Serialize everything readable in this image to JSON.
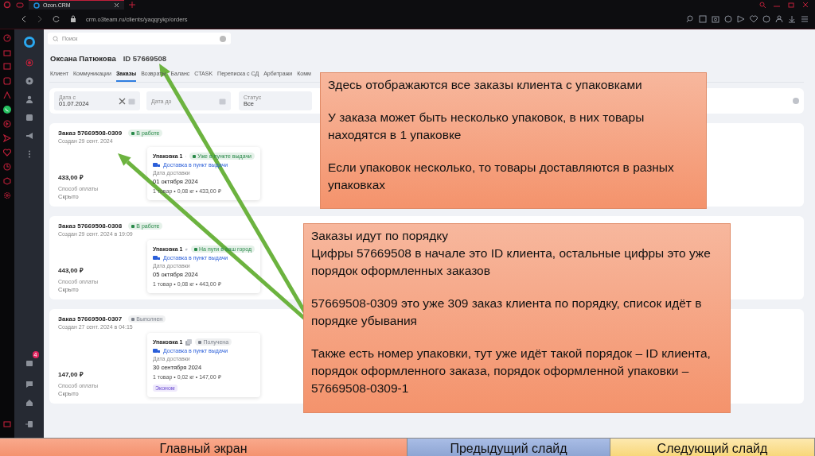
{
  "browser": {
    "tab_title": "Ozon.CRM",
    "url": "crm.o3team.ru/clients/yaqqrykp/orders"
  },
  "app_sidebar": {
    "notification_count": "4"
  },
  "search": {
    "placeholder": "Поиск"
  },
  "client": {
    "name": "Оксана Патюкова",
    "id": "ID 57669508"
  },
  "tabs": [
    {
      "label": "Клиент",
      "selected": false
    },
    {
      "label": "Коммуникации",
      "selected": false
    },
    {
      "label": "Заказы",
      "selected": true
    },
    {
      "label": "Возвраты",
      "selected": false
    },
    {
      "label": "Баланс",
      "selected": false
    },
    {
      "label": "CTASK",
      "selected": false
    },
    {
      "label": "Переписка с СД",
      "selected": false
    },
    {
      "label": "Арбитражи",
      "selected": false
    },
    {
      "label": "Комм",
      "selected": false
    }
  ],
  "filters": [
    {
      "label": "Дата с",
      "value": "01.07.2024",
      "clearable": true
    },
    {
      "label": "Дата до",
      "clearable": false
    },
    {
      "label": "Статус",
      "value": "Все",
      "clearable": false
    }
  ],
  "orders": [
    {
      "title": "Заказ 57669508-0309",
      "status": {
        "text": "В работе",
        "color": "#2a8a4a"
      },
      "created": "Создан 29 сент. 2024",
      "price": "433,00 ₽",
      "payment_label": "Способ оплаты",
      "payment_value": "Скрыто",
      "package": {
        "title": "Упаковка 1",
        "status": {
          "text": "Уже в пункте выдачи",
          "color": "#2a8a4a"
        },
        "delivery": "Доставка в пункт выдачи",
        "date_label": "Дата доставки",
        "date": "01 октября 2024",
        "summary": "1 товар • 0,08 кг • 433,00 ₽"
      }
    },
    {
      "title": "Заказ 57669508-0308",
      "status": {
        "text": "В работе",
        "color": "#2a8a4a"
      },
      "created": "Создан 29 сент. 2024 в 19:09",
      "price": "443,00 ₽",
      "payment_label": "Способ оплаты",
      "payment_value": "Скрыто",
      "package": {
        "title": "Упаковка 1",
        "status": {
          "text": "На пути в ваш город",
          "color": "#2a8a4a"
        },
        "delivery": "Доставка в пункт выдачи",
        "date_label": "Дата доставки",
        "date": "05 октября 2024",
        "summary": "1 товар • 0,08 кг • 443,00 ₽"
      }
    },
    {
      "title": "Заказ 57669508-0307",
      "status": {
        "text": "Выполнен",
        "color": "#7d828c"
      },
      "created": "Создан 27 сент. 2024 в 04:15",
      "price": "147,00 ₽",
      "payment_label": "Способ оплаты",
      "payment_value": "Скрыто",
      "package": {
        "title": "Упаковка 1",
        "status": {
          "text": "Получена",
          "color": "#7d828c"
        },
        "delivery": "Доставка в пункт выдачи",
        "date_label": "Дата доставки",
        "date": "30 сентября 2024",
        "summary": "1 товар • 0,02 кг • 147,00 ₽",
        "tag": "Эконом"
      }
    }
  ],
  "notes": [
    {
      "sections": [
        [
          "Здесь отображаются все заказы клиента с упаковками"
        ],
        [
          "У заказа может быть несколько упаковок, в них товары находятся в 1 упаковке"
        ],
        [
          "Если упаковок несколько, то товары доставляются в разных упаковках"
        ]
      ]
    },
    {
      "sections": [
        [
          "Заказы идут по порядку",
          "Цифры 57669508 в начале это ID клиента, остальные цифры это уже порядок оформленных заказов"
        ],
        [
          "57669508-0309 это уже 309 заказ клиента по порядку, список идёт в порядке убывания"
        ],
        [
          "Также есть номер упаковки, тут уже идёт такой порядок – ID клиента, порядок оформленного заказа, порядок оформленной упаковки – 57669508-0309-1"
        ]
      ]
    }
  ],
  "nav_buttons": [
    {
      "label": "Главный экран",
      "kind": "home"
    },
    {
      "label": "Предыдущий слайд",
      "kind": "prev"
    },
    {
      "label": "Следующий слайд",
      "kind": "next"
    }
  ]
}
